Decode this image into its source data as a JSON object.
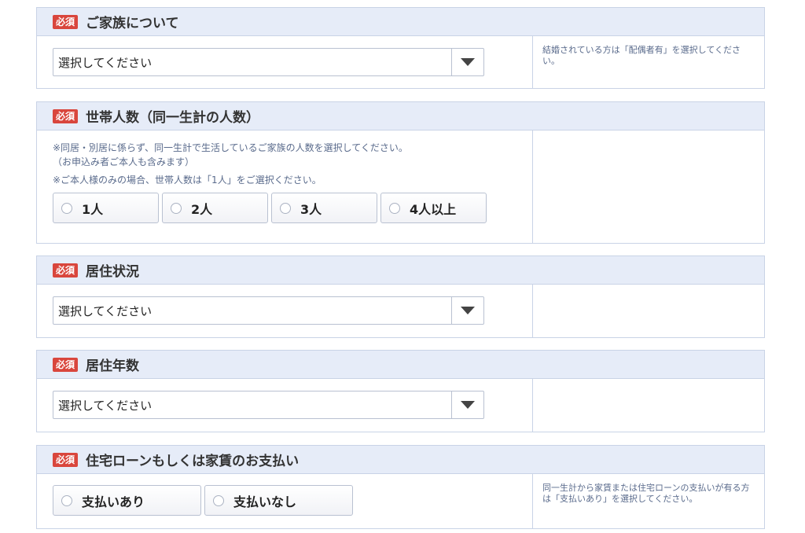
{
  "required_label": "必須",
  "family": {
    "title": "ご家族について",
    "select_value": "選択してください",
    "hint": "結婚されている方は「配偶者有」を選択してください。"
  },
  "household": {
    "title": "世帯人数（同一生計の人数）",
    "note1": "※同居・別居に係らず、同一生計で生活しているご家族の人数を選択してください。",
    "note2": "（お申込み者ご本人も含みます）",
    "note3": "※ご本人様のみの場合、世帯人数は「1人」をご選択ください。",
    "options": [
      "1人",
      "2人",
      "3人",
      "4人以上"
    ]
  },
  "residence": {
    "title": "居住状況",
    "select_value": "選択してください"
  },
  "years": {
    "title": "居住年数",
    "select_value": "選択してください"
  },
  "payment": {
    "title": "住宅ローンもしくは家賃のお支払い",
    "options": [
      "支払いあり",
      "支払いなし"
    ],
    "hint": "同一生計から家賃または住宅ローンの支払いが有る方は「支払いあり」を選択してください。"
  }
}
